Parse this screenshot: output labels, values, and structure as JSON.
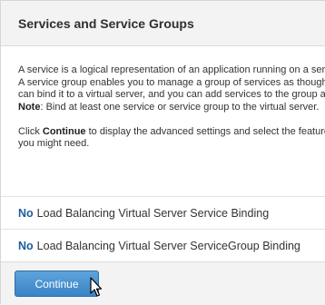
{
  "header": {
    "title": "Services and Service Groups"
  },
  "description": {
    "line1": "A service is a logical representation of an application running on a server.",
    "line2": "A service group enables you to manage a group of services as though it were a single service.",
    "line3": "can bind it to a virtual server, and you can add services to the group as needed.",
    "note_label": "Note",
    "note_text": ": Bind at least one service or service group to the virtual server.",
    "click_prefix": "Click ",
    "continue_word": "Continue",
    "click_suffix": " to display the advanced settings and select the features",
    "line_last": "you might need."
  },
  "bindings": [
    {
      "count": "No",
      "label": "Load Balancing Virtual Server Service Binding"
    },
    {
      "count": "No",
      "label": "Load Balancing Virtual Server ServiceGroup Binding"
    }
  ],
  "footer": {
    "continue_label": "Continue"
  },
  "icons": {
    "cursor": "mouse-pointer-icon"
  }
}
